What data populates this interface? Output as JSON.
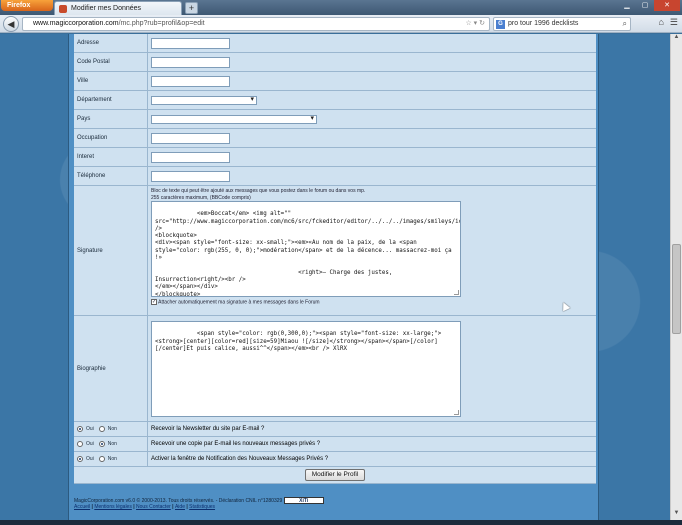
{
  "browser": {
    "menu_button": "Firefox",
    "tab_title": "Modifier mes Données",
    "new_tab": "+",
    "url_host": "www.magiccorporation.com",
    "url_path": "/mc.php?rub=profil&op=edit",
    "search_query": "pro tour 1996 decklists",
    "search_engine_icon": "G"
  },
  "form": {
    "fields": [
      {
        "label": "Adresse"
      },
      {
        "label": "Code Postal"
      },
      {
        "label": "Ville"
      },
      {
        "label": "Département"
      },
      {
        "label": "Pays"
      },
      {
        "label": "Occupation"
      },
      {
        "label": "Interet"
      },
      {
        "label": "Téléphone"
      }
    ],
    "signature": {
      "label": "Signature",
      "hint_line1": "Bloc de texte qui peut être ajouté aux messages que vous postez dans le forum ou dans vos mp.",
      "hint_line2": "255 caractères maximum, (BBCode compris)",
      "value": "<em>Boccat</em> <img alt=\"\" src=\"http://www.magiccorporation.com/mc6/src/fckeditor/editor/../../../images/smileys/icon_rolleyes.gif\" />\n<blockquote>\n<div><span style=\"font-size: xx-small;\"><em>«Au nom de la paix, de la <span style=\"color: rgb(255, 0, 0);\">modération</span> et de la décence... massacrez-moi ça !»\n\n                                         <right>– Charge des justes, Insurrection<right/><br />\n</em></span></div>\n</blockquote>",
      "auto_attach_label": "Attacher automatiquement ma signature à mes messages dans le Forum"
    },
    "biography": {
      "label": "Biographie",
      "value": "<span style=\"color: rgb(0,300,0);\"><span style=\"font-size: xx-large;\"><strong>[center][color=red][size=59]Miaou ![/size]</strong></span></span>[/color][/center]Et puis calice, aussi^^</span></em><br /> XlRX"
    },
    "options": [
      {
        "oui": "Oui",
        "non": "Non",
        "selected": "oui",
        "label": "Recevoir la Newsletter du site par E-mail ?"
      },
      {
        "oui": "Oui",
        "non": "Non",
        "selected": "non",
        "label": "Recevoir une copie par E-mail les nouveaux messages privés ?"
      },
      {
        "oui": "Oui",
        "non": "Non",
        "selected": "oui",
        "label": "Activer la fenêtre de Notification des Nouveaux Messages Privés ?"
      }
    ],
    "submit_label": "Modifier le Profil"
  },
  "footer": {
    "copyright": "MagicCorporation.com v6.0 © 2000-2013. Tous droits réservés. - Déclaration CNIL n°1280329",
    "badge": "XiTi",
    "links": [
      "Accueil",
      "Mentions légales",
      "Nous Contacter",
      "Aide",
      "Statistiques"
    ],
    "separator": " | "
  }
}
